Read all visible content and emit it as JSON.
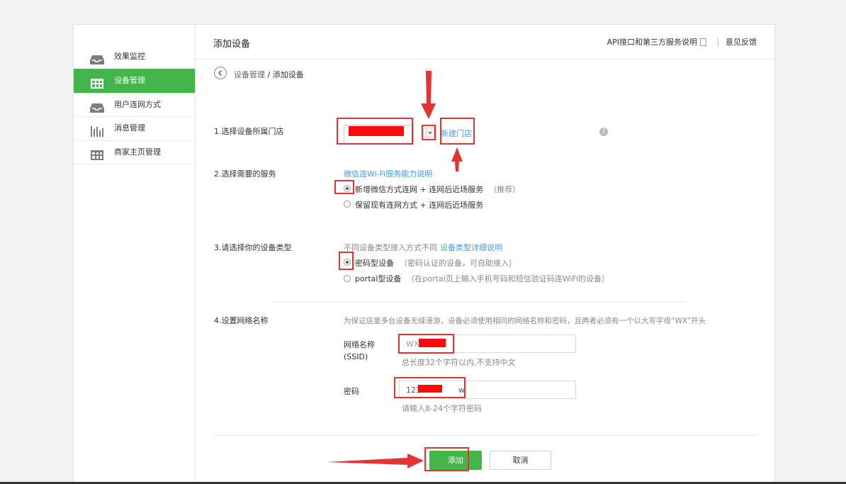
{
  "sidebar": {
    "items": [
      {
        "label": "效果监控",
        "icon": "tray-icon"
      },
      {
        "label": "设备管理",
        "icon": "device-grid-icon"
      },
      {
        "label": "用户连网方式",
        "icon": "tray-icon"
      },
      {
        "label": "消息管理",
        "icon": "bar-chart-icon"
      },
      {
        "label": "商家主页管理",
        "icon": "store-grid-icon"
      }
    ]
  },
  "header": {
    "title": "添加设备",
    "api_link": "API接口和第三方服务说明",
    "feedback_link": "意见反馈"
  },
  "breadcrumb": {
    "parent": "设备管理",
    "separator": " / ",
    "current": "添加设备"
  },
  "form": {
    "store": {
      "label": "1.选择设备所属门店",
      "new_store_link": "新建门店",
      "help_icon": "?"
    },
    "service": {
      "label": "2.选择需要的服务",
      "info_link": "微信连Wi-Fi服务能力说明",
      "options": [
        {
          "text": "新增微信方式连网 + 连网后近场服务",
          "note": "（推荐）",
          "selected": true
        },
        {
          "text": "保留现有连网方式 + 连网后近场服务",
          "note": "",
          "selected": false
        }
      ]
    },
    "device_type": {
      "label": "3.请选择你的设备类型",
      "desc_prefix": "不同设备类型接入方式不同",
      "desc_link": "设备类型详细说明",
      "options": [
        {
          "text": "密码型设备",
          "note": "（密码认证的设备，可自助接入）",
          "selected": true
        },
        {
          "text": "portal型设备",
          "note": "（在portal页上输入手机号码和短信验证码连WiFi的设备）",
          "selected": false
        }
      ]
    },
    "network": {
      "label": "4.设置网络名称",
      "hint": "为保证店里多台设备无缝漫游，设备必须使用相同的网络名称和密码，且两者必须有一个以大写字母“WX”开头",
      "ssid_label": "网络名称",
      "ssid_label2": "(SSID)",
      "ssid_value": "WX",
      "ssid_hint": "总长度32个字符以内,不支持中文",
      "password_label": "密码",
      "password_value_start": "123",
      "password_value_end": "w",
      "password_hint": "请输入8-24个字符密码"
    }
  },
  "buttons": {
    "add": "添加",
    "cancel": "取消"
  },
  "colors": {
    "accent": "#44b549",
    "link": "#459ae9",
    "annotation": "#e53333"
  }
}
